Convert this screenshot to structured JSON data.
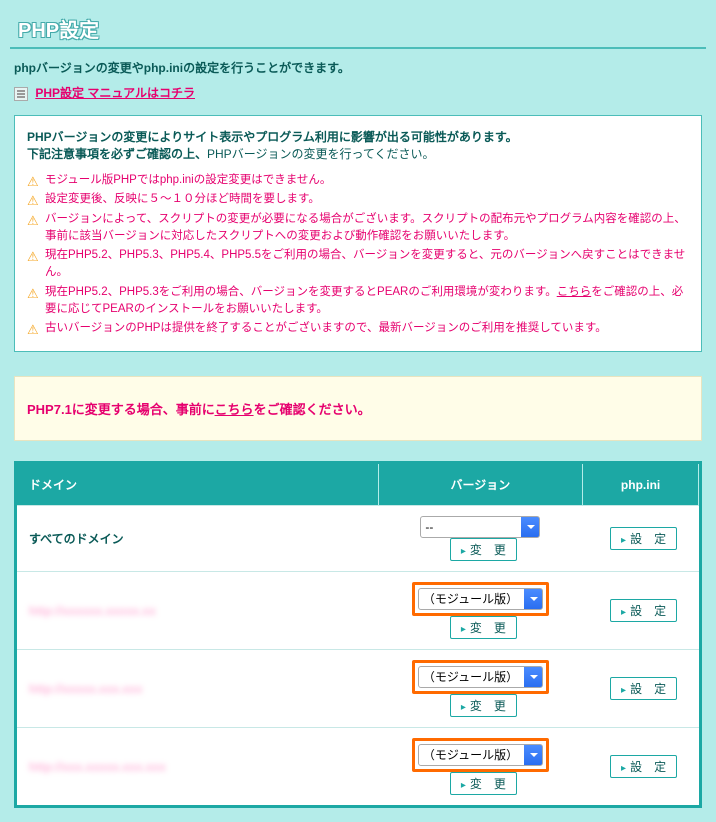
{
  "page": {
    "title": "PHP設定",
    "description": "phpバージョンの変更やphp.iniの設定を行うことができます。",
    "manual_link": "PHP設定 マニュアルはコチラ"
  },
  "warn": {
    "line1": "PHPバージョンの変更によりサイト表示やプログラム利用に影響が出る可能性があります。",
    "line2_bold": "下記注意事項を必ずご確認の上、",
    "line2_rest": "PHPバージョンの変更を行ってください。",
    "items": [
      "モジュール版PHPではphp.iniの設定変更はできません。",
      "設定変更後、反映に５〜１０分ほど時間を要します。",
      "バージョンによって、スクリプトの変更が必要になる場合がございます。スクリプトの配布元やプログラム内容を確認の上、事前に該当バージョンに対応したスクリプトへの変更および動作確認をお願いいたします。",
      "現在PHP5.2、PHP5.3、PHP5.4、PHP5.5をご利用の場合、バージョンを変更すると、元のバージョンへ戻すことはできません。",
      "現在PHP5.2、PHP5.3をご利用の場合、バージョンを変更するとPEARのご利用環境が変わります。こちらをご確認の上、必要に応じてPEARのインストールをお願いいたします。",
      "古いバージョンのPHPは提供を終了することがございますので、最新バージョンのご利用を推奨しています。"
    ]
  },
  "notice": {
    "pre": "PHP7.1に変更する場合、事前に",
    "link": "こちら",
    "post": "をご確認ください。"
  },
  "table": {
    "headers": {
      "domain": "ドメイン",
      "version": "バージョン",
      "phpini": "php.ini"
    },
    "change_btn": "変　更",
    "set_btn": "設　定",
    "rows": [
      {
        "domain": "すべてのドメイン",
        "version": "--",
        "blur": false,
        "highlight": false
      },
      {
        "domain": "http://xxxxxx.xxxxx.xx",
        "version": "（モジュール版）",
        "blur": true,
        "highlight": true
      },
      {
        "domain": "http://xxxxx.xxx.xxx",
        "version": "（モジュール版）",
        "blur": true,
        "highlight": true
      },
      {
        "domain": "http://xxx.xxxxx.xxx.xxx",
        "version": "（モジュール版）",
        "blur": true,
        "highlight": true
      }
    ]
  }
}
